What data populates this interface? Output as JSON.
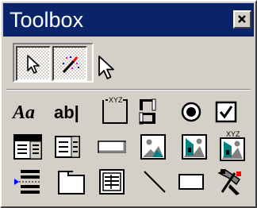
{
  "window": {
    "title": "Toolbox",
    "close_label": "Close"
  },
  "tabs": [
    {
      "id": "pointer",
      "icon": "pointer-arrow-icon",
      "state": "pressed"
    },
    {
      "id": "control-wizards",
      "icon": "magic-wand-icon",
      "state": "pressed"
    }
  ],
  "tools": {
    "label": {
      "text": "Aa",
      "icon": "label-icon"
    },
    "textbox": {
      "text": "ab|",
      "icon": "textbox-icon"
    },
    "option_group": {
      "text": "XYZ",
      "icon": "option-group-icon"
    },
    "toggle_button": {
      "icon": "toggle-button-icon"
    },
    "option_button": {
      "icon": "option-button-icon"
    },
    "check_box": {
      "icon": "check-box-icon"
    },
    "combo_box": {
      "icon": "combo-box-icon"
    },
    "list_box": {
      "icon": "list-box-icon"
    },
    "command_button": {
      "icon": "command-button-icon"
    },
    "image": {
      "icon": "image-icon"
    },
    "unbound_object_frame": {
      "icon": "unbound-object-frame-icon"
    },
    "bound_object_frame": {
      "text": "XYZ",
      "icon": "bound-object-frame-icon"
    },
    "page_break": {
      "icon": "page-break-icon"
    },
    "tab_control": {
      "icon": "tab-control-icon"
    },
    "subform": {
      "icon": "subform-icon"
    },
    "line": {
      "icon": "line-icon"
    },
    "rectangle": {
      "icon": "rectangle-icon"
    },
    "more_controls": {
      "icon": "more-controls-icon"
    }
  },
  "colors": {
    "titlebar": "#0a246a",
    "face": "#d4d0c8",
    "teal": "#008080",
    "blue": "#0000ff"
  }
}
